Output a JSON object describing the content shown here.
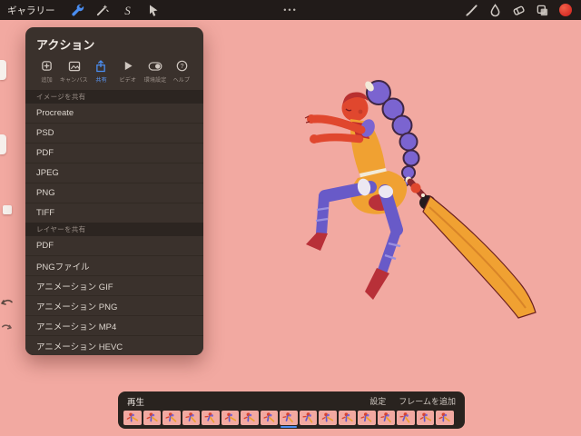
{
  "app": {
    "name": "Procreate"
  },
  "colors": {
    "canvas_pink": "#f2a9a1",
    "topbar": "#211b19",
    "panel": "#3a312c",
    "accent_blue": "#4a8df0",
    "color_swatch": "#e8453a",
    "artwork": {
      "skin": "#e0472e",
      "outfit_orange": "#f0a132",
      "leggings_purple": "#685ac8",
      "braid_purple": "#7b64d0",
      "accent_dark_red": "#b83038"
    }
  },
  "topbar": {
    "gallery_label": "ギャラリー",
    "center_ellipsis": "•••",
    "left_tool_icons": [
      "actions-wrench-icon",
      "adjustments-wand-icon",
      "selection-s-icon",
      "transform-arrow-icon"
    ],
    "right_tool_icons": [
      "brush-icon",
      "smudge-icon",
      "eraser-icon",
      "layers-icon",
      "color-swatch"
    ]
  },
  "actions_panel": {
    "title": "アクション",
    "active_tab": "共有",
    "tabs": [
      {
        "label": "追加",
        "icon": "add-icon"
      },
      {
        "label": "キャンバス",
        "icon": "canvas-icon"
      },
      {
        "label": "共有",
        "icon": "share-icon"
      },
      {
        "label": "ビデオ",
        "icon": "video-icon"
      },
      {
        "label": "環境設定",
        "icon": "preferences-icon"
      },
      {
        "label": "ヘルプ",
        "icon": "help-icon"
      }
    ],
    "image_section": {
      "header": "イメージを共有",
      "items": [
        "Procreate",
        "PSD",
        "PDF",
        "JPEG",
        "PNG",
        "TIFF"
      ]
    },
    "layer_section": {
      "header": "レイヤーを共有",
      "items": [
        "PDF",
        "PNGファイル",
        "アニメーション GIF",
        "アニメーション PNG",
        "アニメーション MP4",
        "アニメーション HEVC"
      ]
    }
  },
  "sidebar": {
    "elements": [
      "brush-size-slider",
      "opacity-slider",
      "modify-button",
      "undo-button",
      "redo-button"
    ]
  },
  "timeline": {
    "play_label": "再生",
    "settings_label": "設定",
    "add_frame_label": "フレームを追加",
    "frames": 17,
    "current_frame": 9
  }
}
